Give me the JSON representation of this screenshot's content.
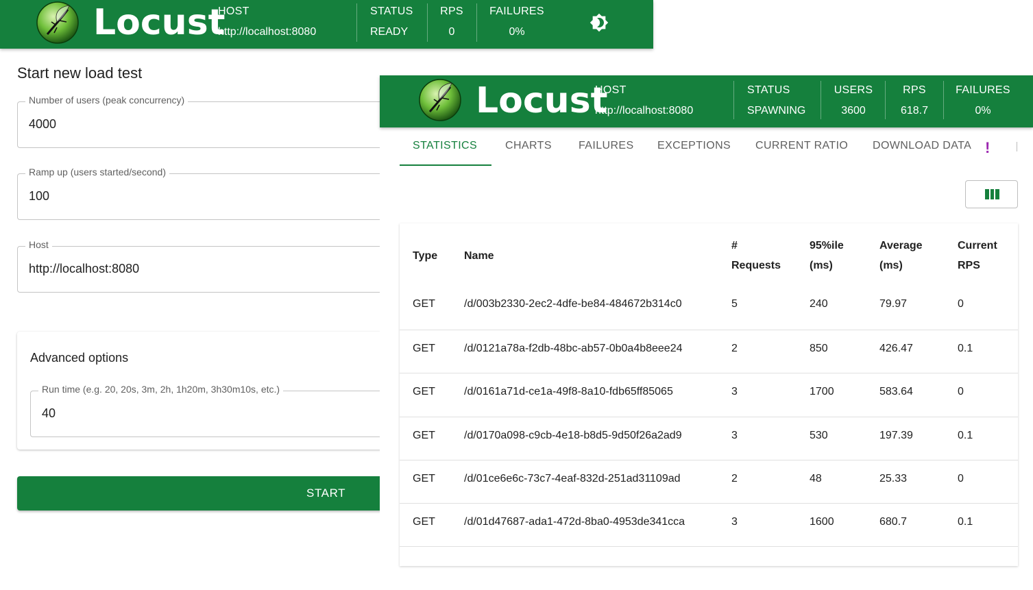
{
  "colors": {
    "brand_green": "#15803d",
    "tab_more_purple": "#9c27b0"
  },
  "left_app": {
    "brand": "Locust",
    "header": {
      "host_label": "HOST",
      "host_value": "http://localhost:8080",
      "status_label": "STATUS",
      "status_value": "READY",
      "rps_label": "RPS",
      "rps_value": "0",
      "failures_label": "FAILURES",
      "failures_value": "0%"
    },
    "theme_toggle_icon": "brightness-icon",
    "form": {
      "title": "Start new load test",
      "users_label": "Number of users (peak concurrency)",
      "users_value": "4000",
      "rampup_label": "Ramp up (users started/second)",
      "rampup_value": "100",
      "host_label": "Host",
      "host_value": "http://localhost:8080",
      "advanced_title": "Advanced options",
      "runtime_label": "Run time (e.g. 20, 20s, 3m, 2h, 1h20m, 3h30m10s, etc.)",
      "runtime_value": "40",
      "start_label": "START"
    }
  },
  "right_app": {
    "brand": "Locust",
    "header": {
      "host_label": "HOST",
      "host_value": "http://localhost:8080",
      "status_label": "STATUS",
      "status_value": "SPAWNING",
      "users_label": "USERS",
      "users_value": "3600",
      "rps_label": "RPS",
      "rps_value": "618.7",
      "failures_label": "FAILURES",
      "failures_value": "0%"
    },
    "tabs": [
      "STATISTICS",
      "CHARTS",
      "FAILURES",
      "EXCEPTIONS",
      "CURRENT RATIO",
      "DOWNLOAD DATA"
    ],
    "tab_more": "!",
    "columns_button_icon": "view-columns-icon",
    "table": {
      "headers": {
        "type": "Type",
        "name": "Name",
        "requests_1": "#",
        "requests_2": "Requests",
        "p95_1": "95%ile",
        "p95_2": "(ms)",
        "avg_1": "Average",
        "avg_2": "(ms)",
        "rps_1": "Current",
        "rps_2": "RPS"
      },
      "rows": [
        {
          "type": "GET",
          "name": "/d/003b2330-2ec2-4dfe-be84-484672b314c0",
          "requests": "5",
          "p95": "240",
          "avg": "79.97",
          "rps": "0"
        },
        {
          "type": "GET",
          "name": "/d/0121a78a-f2db-48bc-ab57-0b0a4b8eee24",
          "requests": "2",
          "p95": "850",
          "avg": "426.47",
          "rps": "0.1"
        },
        {
          "type": "GET",
          "name": "/d/0161a71d-ce1a-49f8-8a10-fdb65ff85065",
          "requests": "3",
          "p95": "1700",
          "avg": "583.64",
          "rps": "0"
        },
        {
          "type": "GET",
          "name": "/d/0170a098-c9cb-4e18-b8d5-9d50f26a2ad9",
          "requests": "3",
          "p95": "530",
          "avg": "197.39",
          "rps": "0.1"
        },
        {
          "type": "GET",
          "name": "/d/01ce6e6c-73c7-4eaf-832d-251ad31109ad",
          "requests": "2",
          "p95": "48",
          "avg": "25.33",
          "rps": "0"
        },
        {
          "type": "GET",
          "name": "/d/01d47687-ada1-472d-8ba0-4953de341cca",
          "requests": "3",
          "p95": "1600",
          "avg": "680.7",
          "rps": "0.1"
        }
      ]
    }
  }
}
